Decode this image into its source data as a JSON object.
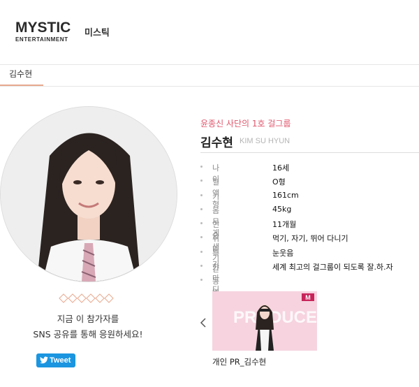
{
  "header": {
    "logo_main": "MYSTIC",
    "logo_sub": "ENTERTAINMENT",
    "agency_name": "미스틱"
  },
  "tabs": [
    {
      "label": "김수현"
    }
  ],
  "profile": {
    "catchphrase": "윤종신 사단의 1호 걸그룹",
    "name": "김수현",
    "name_en": "KIM SU HYUN",
    "cheer_line1": "지금 이 참가자를",
    "cheer_line2": "SNS 공유를 통해 응원하세요!",
    "tweet_label": "Tweet",
    "info": [
      {
        "label": "나이",
        "value": "16세"
      },
      {
        "label": "혈액형",
        "value": "O형"
      },
      {
        "label": "키",
        "value": "161cm"
      },
      {
        "label": "몸무게",
        "value": "45kg"
      },
      {
        "label": "연습생 기간",
        "value": "11개월"
      },
      {
        "label": "취미",
        "value": "먹기, 자기, 뛰어 다니기"
      },
      {
        "label": "특기",
        "value": "눈웃음"
      },
      {
        "label": "한마디",
        "value": "세계 최고의 걸그룹이 되도록 잘.하.자"
      },
      {
        "label": "동영상",
        "value": ""
      }
    ],
    "video_caption": "개인 PR_김수현",
    "video_logo": "M",
    "video_bg_text": "PRODUCE"
  },
  "colors": {
    "accent_red": "#e0556b",
    "tab_underline": "#e8a98f",
    "twitter_blue": "#1b95e0"
  },
  "icons": [
    "profile-photo",
    "diamond-pattern-icon",
    "twitter-bird-icon",
    "chevron-left-icon",
    "video-thumbnail"
  ]
}
